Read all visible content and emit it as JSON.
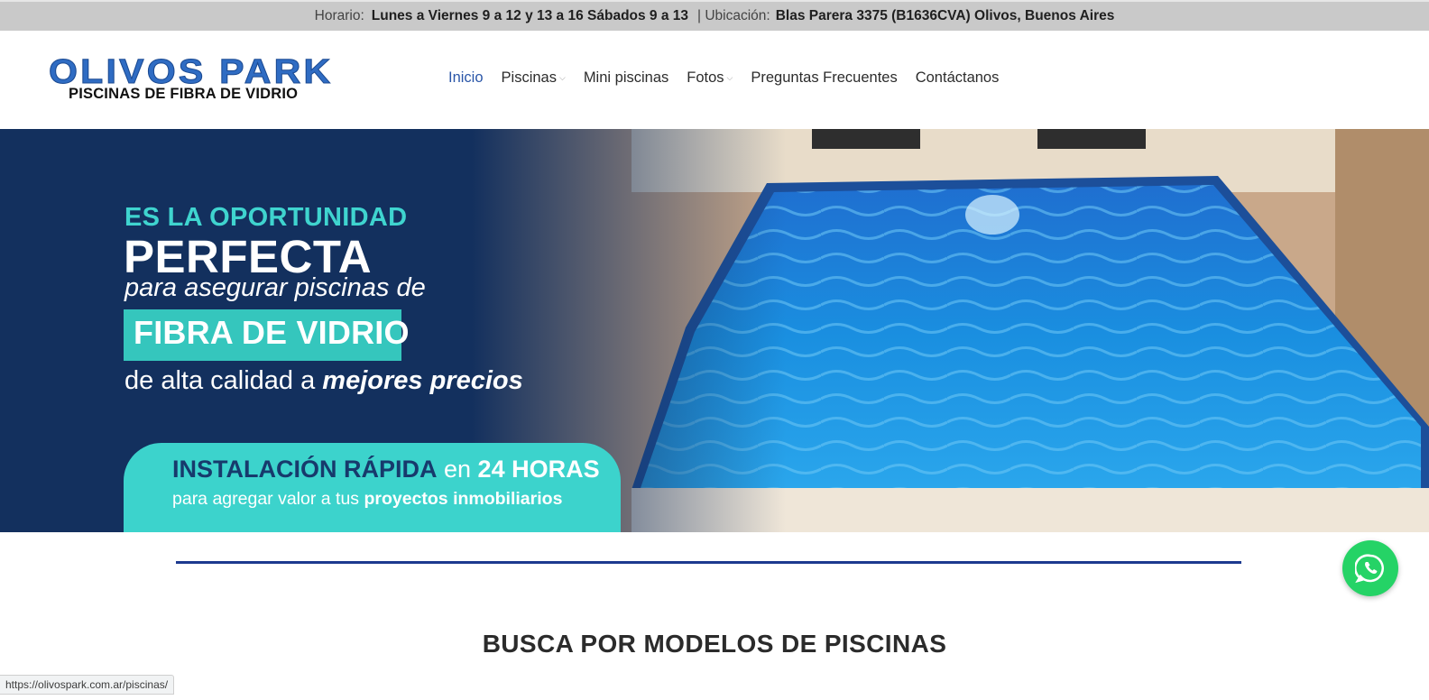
{
  "topbar": {
    "hours_label": "Horario:",
    "hours_value": "Lunes a Viernes 9 a 12 y 13 a 16 Sábados 9 a 13",
    "location_label": "| Ubicación:",
    "location_value": "Blas Parera 3375 (B1636CVA) Olivos, Buenos Aires"
  },
  "logo": {
    "title": "OLIVOS PARK",
    "subtitle": "PISCINAS DE FIBRA DE VIDRIO"
  },
  "nav": {
    "items": [
      {
        "label": "Inicio",
        "active": true,
        "has_dropdown": false
      },
      {
        "label": "Piscinas",
        "active": false,
        "has_dropdown": true
      },
      {
        "label": "Mini piscinas",
        "active": false,
        "has_dropdown": false
      },
      {
        "label": "Fotos",
        "active": false,
        "has_dropdown": true
      },
      {
        "label": "Preguntas Frecuentes",
        "active": false,
        "has_dropdown": false
      },
      {
        "label": "Contáctanos",
        "active": false,
        "has_dropdown": false
      }
    ],
    "chevron": "⌵"
  },
  "hero": {
    "line1": "ES LA OPORTUNIDAD",
    "line2": "PERFECTA",
    "line3": "para asegurar piscinas de",
    "line4": "FIBRA DE VIDRIO",
    "line5_start": "de alta calidad a ",
    "line5_emph": "mejores precios",
    "pill_strong": "INSTALACIÓN RÁPIDA",
    "pill_en": " en ",
    "pill_hours": "24 HORAS",
    "pill_sub_start": "para agregar valor a tus ",
    "pill_sub_emph": "proyectos inmobiliarios"
  },
  "section": {
    "title": "BUSCA POR MODELOS DE PISCINAS"
  },
  "status_url": "https://olivospark.com.ar/piscinas/",
  "colors": {
    "accent": "#2a56a8",
    "navy": "#13305e",
    "teal": "#35c6bd",
    "whatsapp": "#25d366"
  }
}
